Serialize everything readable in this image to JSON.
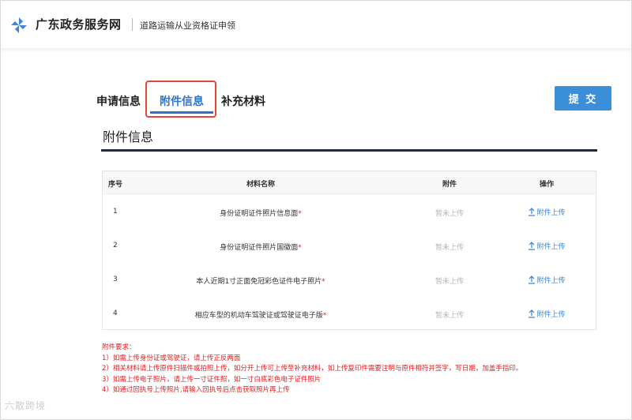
{
  "header": {
    "site_title": "广东政务服务网",
    "page_subtitle": "道路运输从业资格证申领"
  },
  "tabs": [
    {
      "label": "申请信息"
    },
    {
      "label": "附件信息"
    },
    {
      "label": "补充材料"
    }
  ],
  "actions": {
    "submit_label": "提 交"
  },
  "section": {
    "title": "附件信息"
  },
  "table": {
    "headers": {
      "seq": "序号",
      "name": "材料名称",
      "attachment": "附件",
      "operation": "操作"
    },
    "rows": [
      {
        "seq": "1",
        "name": "身份证明证件照片信息面",
        "required_mark": "*",
        "status": "暂未上传",
        "upload": "附件上传"
      },
      {
        "seq": "2",
        "name": "身份证明证件照片国徽面",
        "required_mark": "*",
        "status": "暂未上传",
        "upload": "附件上传"
      },
      {
        "seq": "3",
        "name": "本人近期1寸正面免冠彩色证件电子照片",
        "required_mark": "*",
        "status": "暂未上传",
        "upload": "附件上传"
      },
      {
        "seq": "4",
        "name": "相应车型的机动车驾驶证或驾驶证电子版",
        "required_mark": "*",
        "status": "暂未上传",
        "upload": "附件上传"
      }
    ]
  },
  "notes": {
    "title": "附件要求：",
    "items": [
      "1）如需上传身份证或驾驶证，请上传正反两面",
      "2）相关材料请上传原件扫描件或拍照上传，如分开上传可上传至补充材料，如上传复印件需要注明与原件相符并签字，写日期，加盖手指印。",
      "3）如需上传电子照片，请上传一寸证件照，如一寸白底彩色电子证件照片",
      "4）如通过回执号上传照片,请输入回执号后点击获取照片再上传"
    ]
  },
  "watermark": "六散跨境",
  "colors": {
    "accent": "#2f74c9",
    "submit_bg": "#3b8ed8",
    "highlight_border": "#e0463a",
    "required": "#e02020",
    "muted": "#b5b5b5"
  },
  "icons": {
    "logo": "pinwheel-logo-icon",
    "upload": "upload-icon"
  }
}
